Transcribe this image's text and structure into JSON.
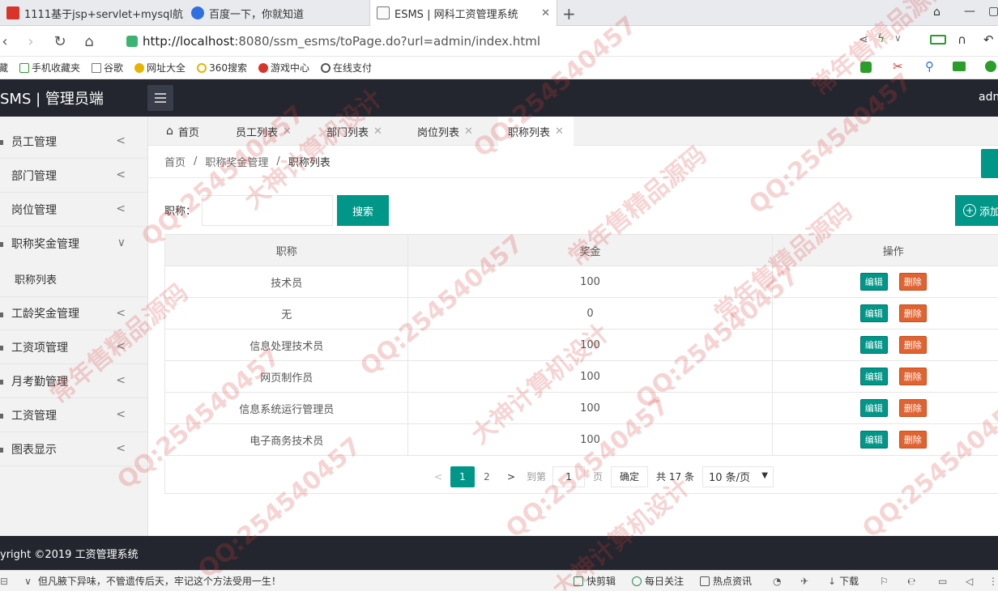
{
  "browser": {
    "tabs": [
      {
        "title": "1111基于jsp+servlet+mysql航"
      },
      {
        "title": "百度一下，你就知道"
      },
      {
        "title": "ESMS | 网科工资管理系统"
      }
    ],
    "new_tab": "+",
    "url_host": "http://localhost",
    "url_rest": ":8080/ssm_esms/toPage.do?url=admin/index.html",
    "bookmarks": [
      "藏",
      "手机收藏夹",
      "谷歌",
      "网址大全",
      "360搜索",
      "游戏中心",
      "在线支付"
    ]
  },
  "header": {
    "logo": "SMS | 管理员端",
    "user": "adm"
  },
  "sidebar": {
    "items": [
      {
        "label": "员工管理",
        "arrow": "<"
      },
      {
        "label": "部门管理",
        "arrow": "<"
      },
      {
        "label": "岗位管理",
        "arrow": "<"
      },
      {
        "label": "职称奖金管理",
        "arrow": "∨"
      },
      {
        "label": "工龄奖金管理",
        "arrow": "<"
      },
      {
        "label": "工资项管理",
        "arrow": "<"
      },
      {
        "label": "月考勤管理",
        "arrow": "<"
      },
      {
        "label": "工资管理",
        "arrow": "<"
      },
      {
        "label": "图表显示",
        "arrow": "<"
      }
    ],
    "subitem": "职称列表"
  },
  "content_tabs": {
    "home": "首页",
    "tabs": [
      "员工列表",
      "部门列表",
      "岗位列表",
      "职称列表"
    ],
    "close": "✕"
  },
  "breadcrumb": {
    "items": [
      "首页",
      "职称奖金管理",
      "职称列表"
    ],
    "sep": "/"
  },
  "search": {
    "label": "职称：",
    "value": "",
    "button": "搜索",
    "add_button": "添加"
  },
  "table": {
    "headers": [
      "职称",
      "奖金",
      "操作"
    ],
    "rows": [
      {
        "title": "技术员",
        "bonus": "100"
      },
      {
        "title": "无",
        "bonus": "0"
      },
      {
        "title": "信息处理技术员",
        "bonus": "100"
      },
      {
        "title": "网页制作员",
        "bonus": "100"
      },
      {
        "title": "信息系统运行管理员",
        "bonus": "100"
      },
      {
        "title": "电子商务技术员",
        "bonus": "100"
      }
    ],
    "edit_label": "编辑",
    "delete_label": "删除"
  },
  "pager": {
    "prev": "<",
    "pages": [
      "1",
      "2"
    ],
    "current_page": "1",
    "next": ">",
    "goto_label": "到第",
    "goto_value": "1",
    "page_unit": "页",
    "confirm": "确定",
    "total": "共 17 条",
    "page_size": "10 条/页"
  },
  "footer": {
    "copyright": "yright ©2019 工资管理系统"
  },
  "statusbar": {
    "news": "但凡腋下异味，不管遗传后天，牢记这个方法受用一生！",
    "items": [
      "快剪辑",
      "每日关注",
      "热点资讯",
      "下载"
    ]
  },
  "watermark": {
    "texts": [
      "QQ:254540457",
      "常年售精品源码",
      "大神计算机设计"
    ]
  },
  "colors": {
    "primary": "#009688",
    "danger": "#e06331",
    "header_bg": "#23262e"
  }
}
